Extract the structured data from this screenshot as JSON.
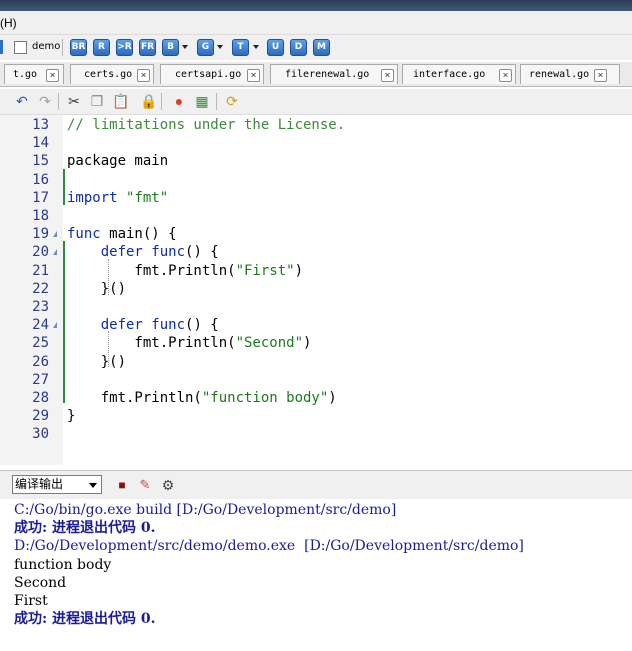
{
  "menu": {
    "partial_label": "(H)"
  },
  "toolbar": {
    "project_label": "demo",
    "buttons": [
      "BR",
      "R",
      ">R",
      "FR",
      "B",
      "G",
      "T",
      "U",
      "D",
      "M"
    ]
  },
  "tabs": [
    "t.go",
    "certs.go",
    "certsapi.go",
    "filerenewal.go",
    "interface.go",
    "renewal.go"
  ],
  "editor": {
    "lines": [
      {
        "n": "13",
        "segments": [
          {
            "t": "// limitations under the License.",
            "c": "c"
          }
        ]
      },
      {
        "n": "14",
        "segments": []
      },
      {
        "n": "15",
        "segments": [
          {
            "t": "package main",
            "c": ""
          }
        ]
      },
      {
        "n": "16",
        "segments": []
      },
      {
        "n": "17",
        "segments": [
          {
            "t": "import ",
            "c": "k"
          },
          {
            "t": "\"fmt\"",
            "c": "s"
          }
        ]
      },
      {
        "n": "18",
        "segments": []
      },
      {
        "n": "19",
        "segments": [
          {
            "t": "func",
            "c": "k"
          },
          {
            "t": " main() {",
            "c": ""
          }
        ]
      },
      {
        "n": "20",
        "segments": [
          {
            "t": "    ",
            "c": ""
          },
          {
            "t": "defer func",
            "c": "k"
          },
          {
            "t": "() {",
            "c": ""
          }
        ]
      },
      {
        "n": "21",
        "segments": [
          {
            "t": "        fmt.Println(",
            "c": ""
          },
          {
            "t": "\"First\"",
            "c": "s"
          },
          {
            "t": ")",
            "c": ""
          }
        ]
      },
      {
        "n": "22",
        "segments": [
          {
            "t": "    }()",
            "c": ""
          }
        ]
      },
      {
        "n": "23",
        "segments": []
      },
      {
        "n": "24",
        "segments": [
          {
            "t": "    ",
            "c": ""
          },
          {
            "t": "defer func",
            "c": "k"
          },
          {
            "t": "() {",
            "c": ""
          }
        ]
      },
      {
        "n": "25",
        "segments": [
          {
            "t": "        fmt.Println(",
            "c": ""
          },
          {
            "t": "\"Second\"",
            "c": "s"
          },
          {
            "t": ")",
            "c": ""
          }
        ]
      },
      {
        "n": "26",
        "segments": [
          {
            "t": "    }()",
            "c": ""
          }
        ]
      },
      {
        "n": "27",
        "segments": []
      },
      {
        "n": "28",
        "segments": [
          {
            "t": "    fmt.Println(",
            "c": ""
          },
          {
            "t": "\"function body\"",
            "c": "s"
          },
          {
            "t": ")",
            "c": ""
          }
        ]
      },
      {
        "n": "29",
        "segments": [
          {
            "t": "}",
            "c": ""
          }
        ]
      },
      {
        "n": "30",
        "segments": []
      }
    ]
  },
  "output_panel": {
    "selector_value": "编译输出",
    "lines": [
      {
        "t": "C:/Go/bin/go.exe build [D:/Go/Development/src/demo]",
        "c": "cmd"
      },
      {
        "t": "成功: 进程退出代码 0.",
        "c": "ok"
      },
      {
        "t": "D:/Go/Development/src/demo/demo.exe  [D:/Go/Development/src/demo]",
        "c": "cmd"
      },
      {
        "t": "function body",
        "c": "plain"
      },
      {
        "t": "Second",
        "c": "plain"
      },
      {
        "t": "First",
        "c": "plain"
      },
      {
        "t": "成功: 进程退出代码 0.",
        "c": "ok"
      }
    ]
  }
}
